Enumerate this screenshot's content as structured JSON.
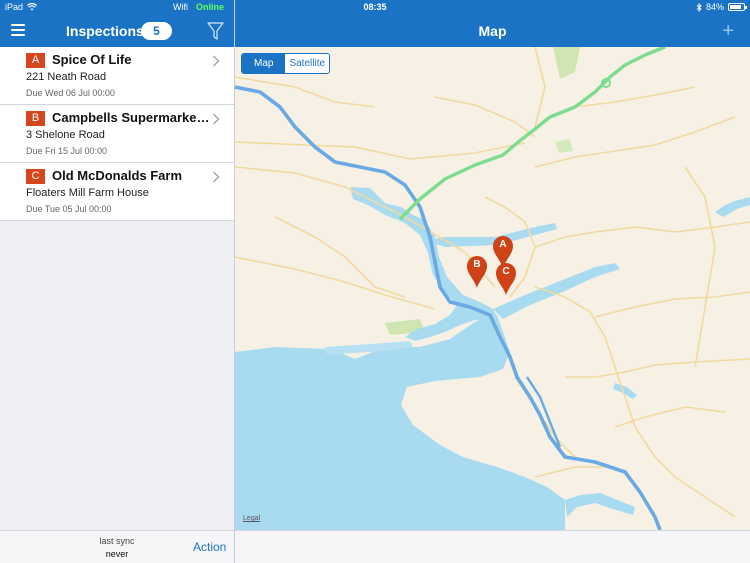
{
  "status_bar": {
    "device": "iPad",
    "network_label": "Wifi",
    "online_label": "Online",
    "time": "08:35",
    "battery": "84%",
    "battery_level": 0.84
  },
  "sidebar": {
    "title": "Inspections",
    "count": "5",
    "items": [
      {
        "badge": "A",
        "title": "Spice Of Life",
        "address": "221 Neath Road",
        "due": "Due Wed 06 Jul 00:00"
      },
      {
        "badge": "B",
        "title": "Campbells Supermarket...",
        "address": "3 Shelone Road",
        "due": "Due Fri 15 Jul 00:00"
      },
      {
        "badge": "C",
        "title": "Old McDonalds Farm",
        "address": "Floaters Mill Farm House",
        "due": "Due Tue 05 Jul 00:00"
      }
    ],
    "footer": {
      "sync_label": "last sync",
      "sync_value": "never",
      "action_label": "Action"
    }
  },
  "map": {
    "title": "Map",
    "toggle": {
      "map_label": "Map",
      "satellite_label": "Satellite",
      "selected": "Map"
    },
    "legal_label": "Legal",
    "pins": [
      {
        "label": "A"
      },
      {
        "label": "B"
      },
      {
        "label": "C"
      }
    ]
  },
  "colors": {
    "accent": "#1a73c4",
    "badge": "#d6461d",
    "online": "#5dff5a",
    "water": "#a8dbf0",
    "highway": "#6aa9e4",
    "motorway": "#7ddc8e",
    "map_land": "#f6f1e4"
  },
  "icons": {
    "menu": "hamburger-icon",
    "filter": "filter-icon",
    "add": "plus-icon",
    "chevron": "chevron-right-icon",
    "wifi": "wifi-icon",
    "bluetooth": "bluetooth-icon",
    "battery": "battery-icon"
  }
}
